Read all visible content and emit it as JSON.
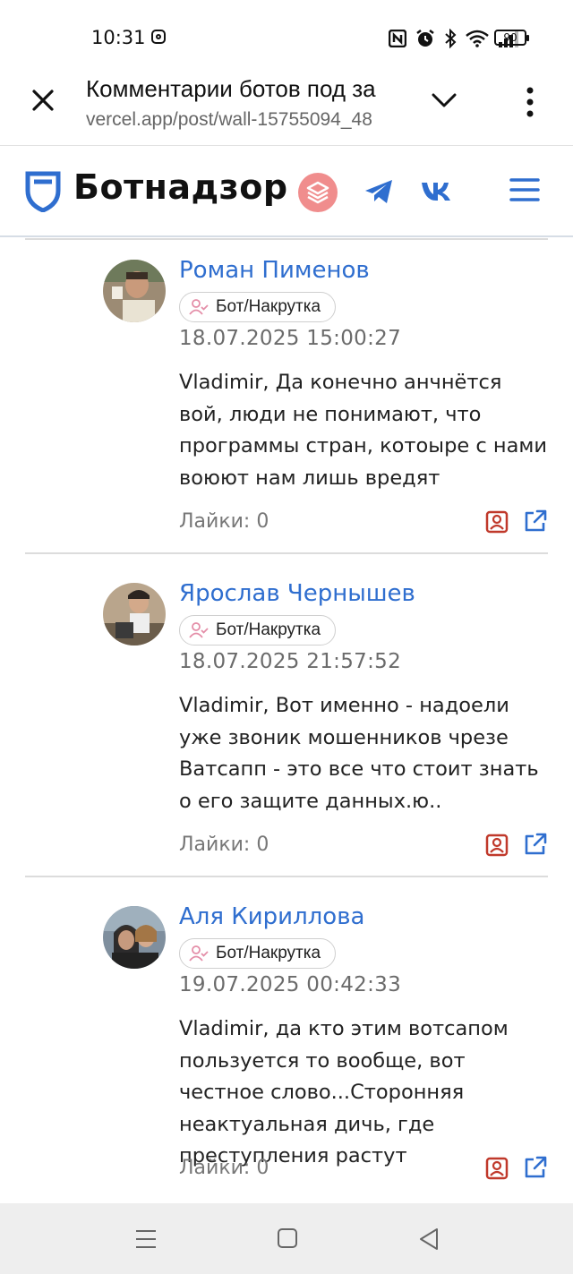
{
  "status_bar": {
    "time": "10:31",
    "battery": "90",
    "icons": [
      "instagram-icon",
      "nfc-icon",
      "alarm-icon",
      "bluetooth-icon",
      "wifi-icon",
      "signal-icon",
      "battery-icon"
    ]
  },
  "browser": {
    "title": "Комментарии ботов под за",
    "url": "vercel.app/post/wall-15755094_48"
  },
  "site": {
    "logo_text": "Ботнадзор",
    "colors": {
      "brand": "#2f6ecf",
      "accent_circle": "#f08d8d",
      "danger": "#c0392b"
    }
  },
  "comments": [
    {
      "author": "Роман Пименов",
      "badge": "Бот/Накрутка",
      "date": "18.07.2025 15:00:27",
      "text": "Vladimir, Да конечно анчнётся вой, люди не понимают, что программы стран, котоыре с нами воюют нам лишь вредят",
      "likes": "Лайки: 0"
    },
    {
      "author": "Ярослав Чернышев",
      "badge": "Бот/Накрутка",
      "date": "18.07.2025 21:57:52",
      "text": "Vladimir, Вот именно - надоели уже звоник мошенников чрезе Ватсапп - это все что стоит знать о его защите данных.ю..",
      "likes": "Лайки: 0"
    },
    {
      "author": "Аля Кириллова",
      "badge": "Бот/Накрутка",
      "date": "19.07.2025 00:42:33",
      "text": "Vladimir, да кто этим вотсапом пользуется то вообще, вот честное слово...Сторонняя неактуальная дичь, где преступления растут",
      "likes": "Лайки: 0"
    }
  ]
}
